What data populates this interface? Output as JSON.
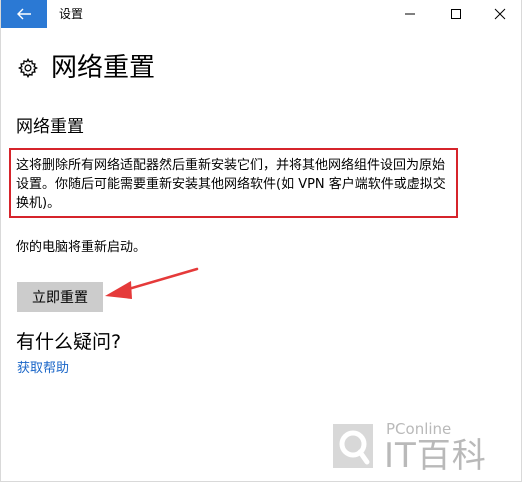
{
  "window": {
    "title": "设置"
  },
  "page": {
    "title": "网络重置"
  },
  "section": {
    "title": "网络重置",
    "description": "这将删除所有网络适配器然后重新安装它们，并将其他网络组件设回为原始设置。你随后可能需要重新安装其他网络软件(如 VPN 客户端软件或虚拟交换机)。",
    "restart_note": "你的电脑将重新启动。",
    "reset_button_label": "立即重置"
  },
  "help": {
    "question": "有什么疑问?",
    "link_label": "获取帮助"
  },
  "watermark": {
    "sub": "PConline",
    "main": "IT百科"
  },
  "colors": {
    "accent": "#2b79d4",
    "highlight_border": "#d6242b",
    "arrow": "#e53a3a",
    "link": "#1a66c8",
    "button_bg": "#cccccc"
  },
  "icons": {
    "back": "arrow-left-icon",
    "minimize": "minimize-icon",
    "maximize": "maximize-icon",
    "close": "close-icon",
    "page": "gear-icon"
  }
}
